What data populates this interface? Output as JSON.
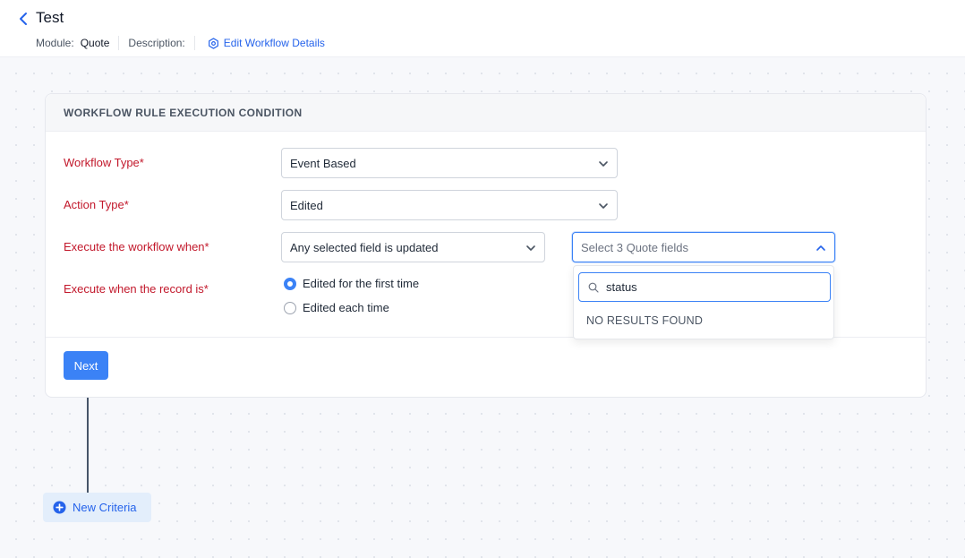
{
  "header": {
    "title": "Test",
    "module_label": "Module:",
    "module_value": "Quote",
    "description_label": "Description:",
    "edit_link": "Edit Workflow Details"
  },
  "card": {
    "heading": "WORKFLOW RULE EXECUTION CONDITION",
    "fields": {
      "workflow_type": {
        "label": "Workflow Type*",
        "value": "Event Based"
      },
      "action_type": {
        "label": "Action Type*",
        "value": "Edited"
      },
      "execute_when": {
        "label": "Execute the workflow when*",
        "value": "Any selected field is updated",
        "fields_placeholder": "Select 3 Quote fields"
      },
      "record_is": {
        "label": "Execute when the record is*",
        "options": [
          {
            "label": "Edited for the first time",
            "checked": true
          },
          {
            "label": "Edited each time",
            "checked": false
          }
        ]
      }
    },
    "next_label": "Next"
  },
  "dropdown": {
    "search_value": "status",
    "empty_text": "NO RESULTS FOUND"
  },
  "criteria": {
    "label": "New Criteria"
  },
  "colors": {
    "accent": "#3b82f6",
    "required_label": "#c2182b",
    "link": "#2563eb"
  },
  "icons": [
    "chevron-left-icon",
    "gear-icon",
    "chevron-down-icon",
    "chevron-up-icon",
    "search-icon",
    "plus-circle-icon"
  ]
}
